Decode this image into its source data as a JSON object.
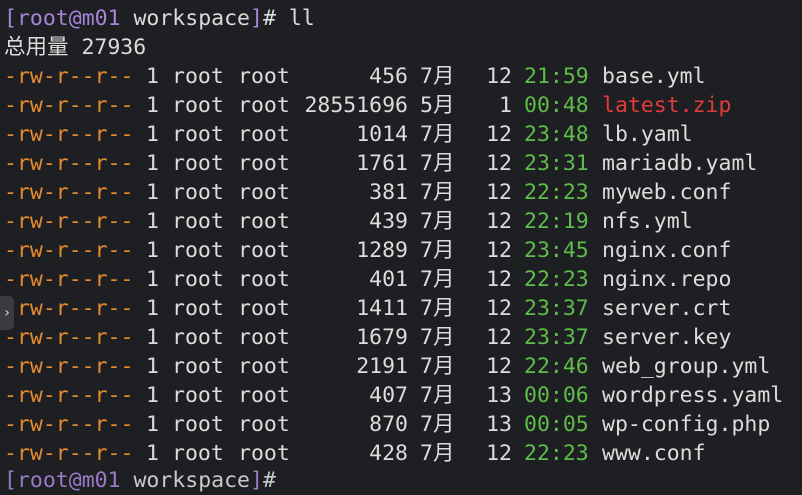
{
  "prompt": {
    "open_bracket": "[",
    "user": "root",
    "at": "@",
    "host": "m01",
    "dir": " workspace",
    "close_bracket": "]",
    "hash": "# ",
    "command": "ll"
  },
  "total_line": "总用量 27936",
  "files": [
    {
      "perm": "-rw-r--r--",
      "links": "1",
      "owner": "root",
      "group": "root",
      "size": "456",
      "month": "7月",
      "day": "12",
      "time": "21:59",
      "name": "base.yml",
      "highlight": false
    },
    {
      "perm": "-rw-r--r--",
      "links": "1",
      "owner": "root",
      "group": "root",
      "size": "28551696",
      "month": "5月",
      "day": "1",
      "time": "00:48",
      "name": "latest.zip",
      "highlight": true
    },
    {
      "perm": "-rw-r--r--",
      "links": "1",
      "owner": "root",
      "group": "root",
      "size": "1014",
      "month": "7月",
      "day": "12",
      "time": "23:48",
      "name": "lb.yaml",
      "highlight": false
    },
    {
      "perm": "-rw-r--r--",
      "links": "1",
      "owner": "root",
      "group": "root",
      "size": "1761",
      "month": "7月",
      "day": "12",
      "time": "23:31",
      "name": "mariadb.yaml",
      "highlight": false
    },
    {
      "perm": "-rw-r--r--",
      "links": "1",
      "owner": "root",
      "group": "root",
      "size": "381",
      "month": "7月",
      "day": "12",
      "time": "22:23",
      "name": "myweb.conf",
      "highlight": false
    },
    {
      "perm": "-rw-r--r--",
      "links": "1",
      "owner": "root",
      "group": "root",
      "size": "439",
      "month": "7月",
      "day": "12",
      "time": "22:19",
      "name": "nfs.yml",
      "highlight": false
    },
    {
      "perm": "-rw-r--r--",
      "links": "1",
      "owner": "root",
      "group": "root",
      "size": "1289",
      "month": "7月",
      "day": "12",
      "time": "23:45",
      "name": "nginx.conf",
      "highlight": false
    },
    {
      "perm": "-rw-r--r--",
      "links": "1",
      "owner": "root",
      "group": "root",
      "size": "401",
      "month": "7月",
      "day": "12",
      "time": "22:23",
      "name": "nginx.repo",
      "highlight": false
    },
    {
      "perm": "-rw-r--r--",
      "links": "1",
      "owner": "root",
      "group": "root",
      "size": "1411",
      "month": "7月",
      "day": "12",
      "time": "23:37",
      "name": "server.crt",
      "highlight": false
    },
    {
      "perm": "-rw-r--r--",
      "links": "1",
      "owner": "root",
      "group": "root",
      "size": "1679",
      "month": "7月",
      "day": "12",
      "time": "23:37",
      "name": "server.key",
      "highlight": false
    },
    {
      "perm": "-rw-r--r--",
      "links": "1",
      "owner": "root",
      "group": "root",
      "size": "2191",
      "month": "7月",
      "day": "12",
      "time": "22:46",
      "name": "web_group.yml",
      "highlight": false
    },
    {
      "perm": "-rw-r--r--",
      "links": "1",
      "owner": "root",
      "group": "root",
      "size": "407",
      "month": "7月",
      "day": "13",
      "time": "00:06",
      "name": "wordpress.yaml",
      "highlight": false
    },
    {
      "perm": "-rw-r--r--",
      "links": "1",
      "owner": "root",
      "group": "root",
      "size": "870",
      "month": "7月",
      "day": "13",
      "time": "00:05",
      "name": "wp-config.php",
      "highlight": false
    },
    {
      "perm": "-rw-r--r--",
      "links": "1",
      "owner": "root",
      "group": "root",
      "size": "428",
      "month": "7月",
      "day": "12",
      "time": "22:23",
      "name": "www.conf",
      "highlight": false
    }
  ],
  "scroll_tab_icon": "chevron-right-icon",
  "scroll_tab_glyph": "›",
  "colors": {
    "background": "#1e1f22",
    "permissions": "#e58a2e",
    "time": "#5ebd4a",
    "prompt": "#a684d8",
    "archive": "#e23b3b",
    "text": "#dcdcdc"
  }
}
